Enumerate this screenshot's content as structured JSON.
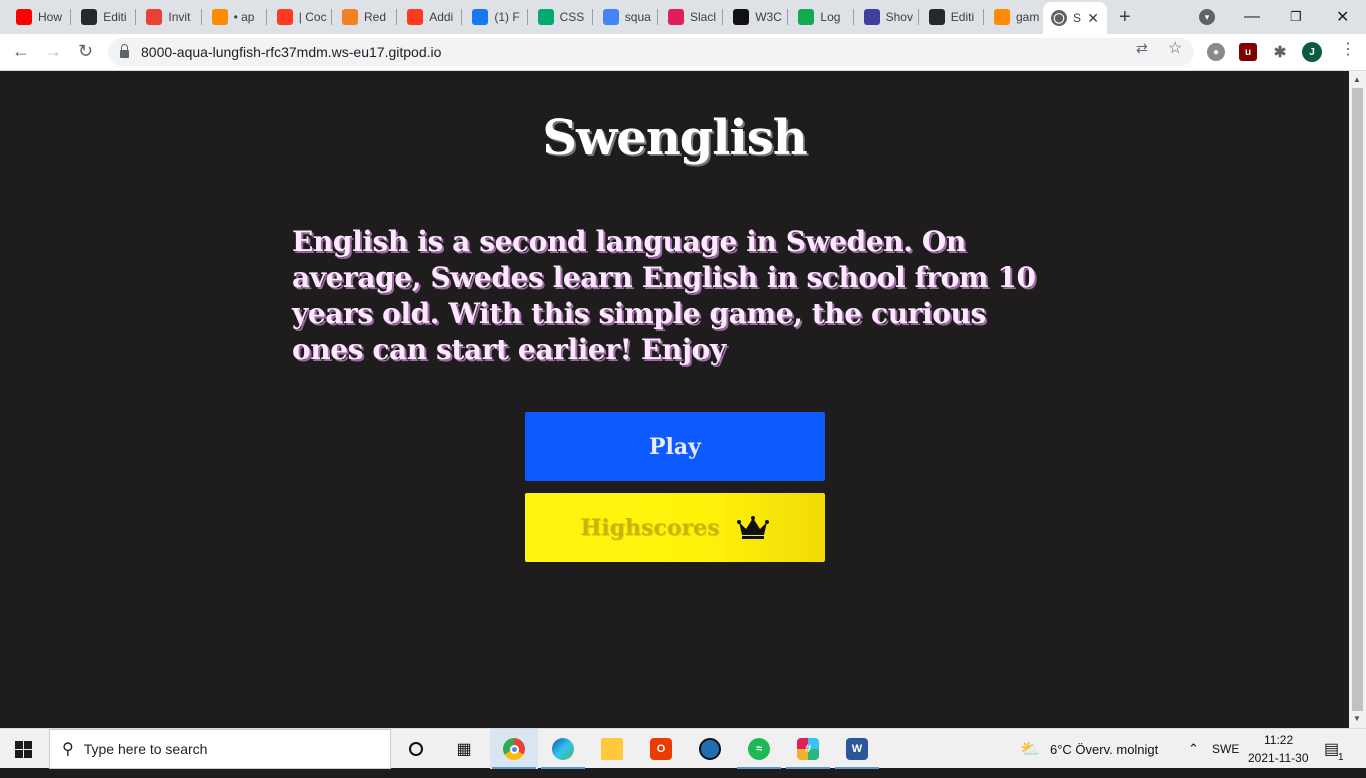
{
  "browser": {
    "tabs": [
      {
        "label": "How",
        "icon": "youtube-icon",
        "color": "#ff0000"
      },
      {
        "label": "Editi",
        "icon": "github-icon",
        "color": "#24292e"
      },
      {
        "label": "Invit",
        "icon": "gmail-icon",
        "color": "#ea4335"
      },
      {
        "label": "• ap",
        "icon": "gitpod-icon",
        "color": "#ff8a00"
      },
      {
        "label": "| Coc",
        "icon": "opera-icon",
        "color": "#ff3b1f"
      },
      {
        "label": "Red",
        "icon": "stackoverflow-icon",
        "color": "#f48024"
      },
      {
        "label": "Addi",
        "icon": "opera-icon",
        "color": "#ff3b1f"
      },
      {
        "label": "(1) F",
        "icon": "facebook-icon",
        "color": "#1877f2"
      },
      {
        "label": "CSS",
        "icon": "w3schools-icon",
        "color": "#04aa6d"
      },
      {
        "label": "squa",
        "icon": "google-icon",
        "color": "#4285f4"
      },
      {
        "label": "Slacl",
        "icon": "slack-icon",
        "color": "#e01e5a"
      },
      {
        "label": "W3C",
        "icon": "w3c-icon",
        "color": "#111111"
      },
      {
        "label": "Log",
        "icon": "leaf-icon",
        "color": "#13aa52"
      },
      {
        "label": "Shov",
        "icon": "readme-icon",
        "color": "#3f3f9f"
      },
      {
        "label": "Editi",
        "icon": "github-icon",
        "color": "#24292e"
      },
      {
        "label": "gam",
        "icon": "gitpod-icon",
        "color": "#ff8a00"
      }
    ],
    "active_tab": {
      "label": "S",
      "icon": "globe-icon",
      "close": "✕"
    },
    "new_tab": "+",
    "url": "8000-aqua-lungfish-rfc37mdm.ws-eu17.gitpod.io",
    "profile_initial": "J",
    "win_min": "—",
    "win_restore": "❐",
    "win_close": "✕"
  },
  "page": {
    "title": "Swenglish",
    "intro": "English is a second language in Sweden. On average, Swedes learn English in school from 10 years old. With this simple game, the curious ones can start earlier! Enjoy",
    "play_label": "Play",
    "highscores_label": "Highscores",
    "play_color": "#0d5bff",
    "highscores_color": "#fff510"
  },
  "taskbar": {
    "search_placeholder": "Type here to search",
    "weather": "6°C  Överv. molnigt",
    "language": "SWE",
    "time": "11:22",
    "date": "2021-11-30",
    "notification_count": "1"
  }
}
